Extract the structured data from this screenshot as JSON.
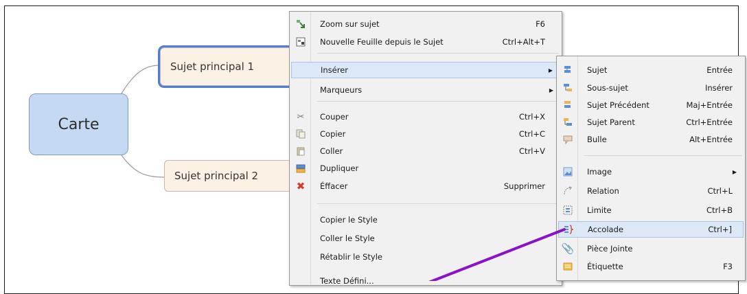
{
  "map": {
    "central_topic": "Carte",
    "main_topic_1": "Sujet principal  1",
    "main_topic_2": "Sujet principal  2"
  },
  "context_menu": {
    "items": [
      {
        "label": "Zoom sur sujet",
        "shortcut": "F6",
        "icon": "zoom-topic-icon"
      },
      {
        "label": "Nouvelle Feuille depuis le Sujet",
        "shortcut": "Ctrl+Alt+T",
        "icon": "new-sheet-icon"
      },
      {
        "label": "Insérer",
        "shortcut": "",
        "icon": "",
        "submenu": true,
        "highlighted": true
      },
      {
        "label": "Marqueurs",
        "shortcut": "",
        "icon": "",
        "submenu": true
      },
      {
        "label": "Couper",
        "shortcut": "Ctrl+X",
        "icon": "scissors-icon"
      },
      {
        "label": "Copier",
        "shortcut": "Ctrl+C",
        "icon": "copy-icon"
      },
      {
        "label": "Coller",
        "shortcut": "Ctrl+V",
        "icon": "paste-icon"
      },
      {
        "label": "Dupliquer",
        "shortcut": "",
        "icon": "duplicate-icon"
      },
      {
        "label": "Éffacer",
        "shortcut": "Supprimer",
        "icon": "delete-icon"
      },
      {
        "label": "Copier le Style",
        "shortcut": ""
      },
      {
        "label": "Coller le Style",
        "shortcut": ""
      },
      {
        "label": "Rétablir le Style",
        "shortcut": ""
      },
      {
        "label": "Texte Défini...",
        "shortcut": ""
      }
    ]
  },
  "insert_submenu": {
    "items": [
      {
        "label": "Sujet",
        "shortcut": "Entrée",
        "icon": "topic-icon"
      },
      {
        "label": "Sous-sujet",
        "shortcut": "Insérer",
        "icon": "subtopic-icon"
      },
      {
        "label": "Sujet Précédent",
        "shortcut": "Maj+Entrée",
        "icon": "previous-topic-icon"
      },
      {
        "label": "Sujet Parent",
        "shortcut": "Ctrl+Entrée",
        "icon": "parent-topic-icon"
      },
      {
        "label": "Bulle",
        "shortcut": "Alt+Entrée",
        "icon": "callout-icon"
      },
      {
        "label": "Image",
        "shortcut": "",
        "icon": "image-icon",
        "submenu": true
      },
      {
        "label": "Relation",
        "shortcut": "Ctrl+L",
        "icon": "relationship-icon"
      },
      {
        "label": "Limite",
        "shortcut": "Ctrl+B",
        "icon": "boundary-icon"
      },
      {
        "label": "Accolade",
        "shortcut": "Ctrl+]",
        "icon": "summary-brace-icon",
        "highlighted": true
      },
      {
        "label": "Pièce Jointe",
        "shortcut": "",
        "icon": "attachment-icon"
      },
      {
        "label": "Étiquette",
        "shortcut": "F3",
        "icon": "label-icon"
      }
    ]
  },
  "colors": {
    "central_fill": "#c6d9f3",
    "topic_fill": "#fbf1e4",
    "selection": "#4f7ed8",
    "pointer": "#8a13c8",
    "menu_bg": "#f1f1f1",
    "highlight": "#dde8f6"
  }
}
